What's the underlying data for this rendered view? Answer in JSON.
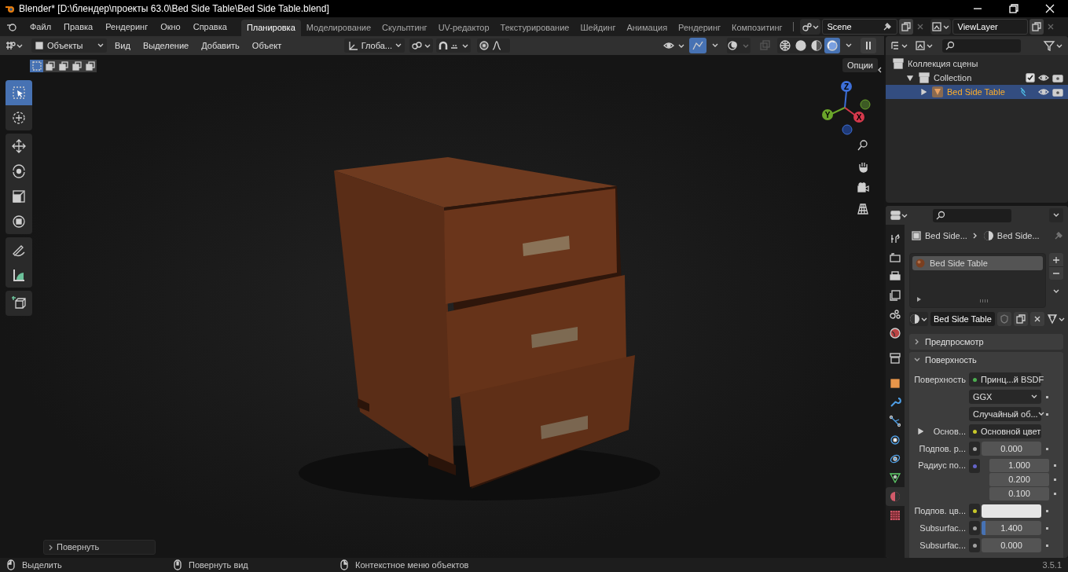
{
  "window": {
    "title": "Blender* [D:\\блендер\\проекты 63.0\\Bed Side Table\\Bed Side Table.blend]"
  },
  "menu": [
    "Файл",
    "Правка",
    "Рендеринг",
    "Окно",
    "Справка"
  ],
  "workspaces": [
    {
      "label": "Планировка",
      "selected": true
    },
    {
      "label": "Моделирование",
      "selected": false
    },
    {
      "label": "Скульптинг",
      "selected": false
    },
    {
      "label": "UV-редактор",
      "selected": false
    },
    {
      "label": "Текстурирование",
      "selected": false
    },
    {
      "label": "Шейдинг",
      "selected": false
    },
    {
      "label": "Анимация",
      "selected": false
    },
    {
      "label": "Рендеринг",
      "selected": false
    },
    {
      "label": "Композитинг",
      "selected": false
    }
  ],
  "scene": "Scene",
  "view_layer": "ViewLayer",
  "viewport": {
    "mode": "Объекты",
    "menus": [
      "Вид",
      "Выделение",
      "Добавить",
      "Объект"
    ],
    "orientation": "Глоба...",
    "options": "Опции",
    "select_modes": [
      {
        "selected": true
      },
      {
        "selected": false
      },
      {
        "selected": false
      },
      {
        "selected": false
      },
      {
        "selected": false
      }
    ],
    "shading": [
      {
        "selected": false
      },
      {
        "selected": false
      },
      {
        "selected": false
      },
      {
        "selected": true
      }
    ],
    "tools": [
      {
        "kind": "select",
        "selected": true
      },
      {
        "kind": "cursor",
        "selected": false
      },
      {
        "kind": "move",
        "selected": false
      },
      {
        "kind": "rotate",
        "selected": false
      },
      {
        "kind": "scale",
        "selected": false
      },
      {
        "kind": "transform",
        "selected": false
      },
      {
        "kind": "annotate",
        "selected": false
      },
      {
        "kind": "measure",
        "selected": false
      },
      {
        "kind": "add_cube",
        "selected": false
      }
    ],
    "gizmo": {
      "x": "X",
      "y": "Y",
      "z": "Z"
    },
    "last_operation": "Повернуть"
  },
  "outliner": {
    "items": [
      {
        "label": "Коллекция сцены",
        "children": [
          {
            "label": "Collection",
            "expanded": true,
            "checked": true,
            "selected": false,
            "children": [
              {
                "label": "Bed Side Table",
                "expanded": false,
                "selected": true
              }
            ]
          }
        ]
      }
    ]
  },
  "properties": {
    "tabs": [
      {
        "kind": "tool",
        "selected": false
      },
      {
        "kind": "render",
        "selected": false
      },
      {
        "kind": "output",
        "selected": false
      },
      {
        "kind": "view_layer",
        "selected": false
      },
      {
        "kind": "scene",
        "selected": false
      },
      {
        "kind": "world",
        "selected": false
      },
      {
        "kind": "collection",
        "selected": false
      },
      {
        "kind": "object",
        "selected": false
      },
      {
        "kind": "modifier",
        "selected": false
      },
      {
        "kind": "particles",
        "selected": false
      },
      {
        "kind": "physics",
        "selected": false
      },
      {
        "kind": "constraints",
        "selected": false
      },
      {
        "kind": "data",
        "selected": false
      },
      {
        "kind": "material",
        "selected": true
      },
      {
        "kind": "texture",
        "selected": false
      }
    ],
    "breadcrumb": [
      "Bed Side...",
      "Bed Side..."
    ],
    "material_slots": [
      {
        "name": "Bed Side Table",
        "selected": true
      }
    ],
    "material_name": "Bed Side Table",
    "panels": [
      {
        "label": "Предпросмотр",
        "expanded": false
      },
      {
        "label": "Поверхность",
        "expanded": true
      }
    ],
    "fields": [
      {
        "kind": "socket",
        "label": "Поверхность",
        "value": "Принц...й BSDF",
        "color": "#4caf50"
      },
      {
        "kind": "dropdown",
        "value": "GGX"
      },
      {
        "kind": "dropdown",
        "value": "Случайный об..."
      },
      {
        "kind": "socket",
        "label": "Основ...",
        "value": "Основной цвет",
        "color": "#c7c729",
        "expanded": false
      },
      {
        "kind": "number",
        "label": "Подпов. р...",
        "value": "0.000",
        "color": "#a1a1a1"
      },
      {
        "kind": "vector",
        "label": "Радиус по...",
        "values": [
          "1.000",
          "0.200",
          "0.100"
        ],
        "color": "#6363c7"
      },
      {
        "kind": "swatch",
        "label": "Подпов. цв...",
        "color": "#c7c729"
      },
      {
        "kind": "slider",
        "label": "Subsurfac...",
        "value": "1.400",
        "level": 0.06,
        "color": "#a1a1a1"
      },
      {
        "kind": "number",
        "label": "Subsurfac...",
        "value": "0.000",
        "color": "#a1a1a1"
      }
    ]
  },
  "status_bar": {
    "items": [
      "Выделить",
      "Повернуть вид",
      "Контекстное меню объектов"
    ],
    "version": "3.5.1"
  }
}
